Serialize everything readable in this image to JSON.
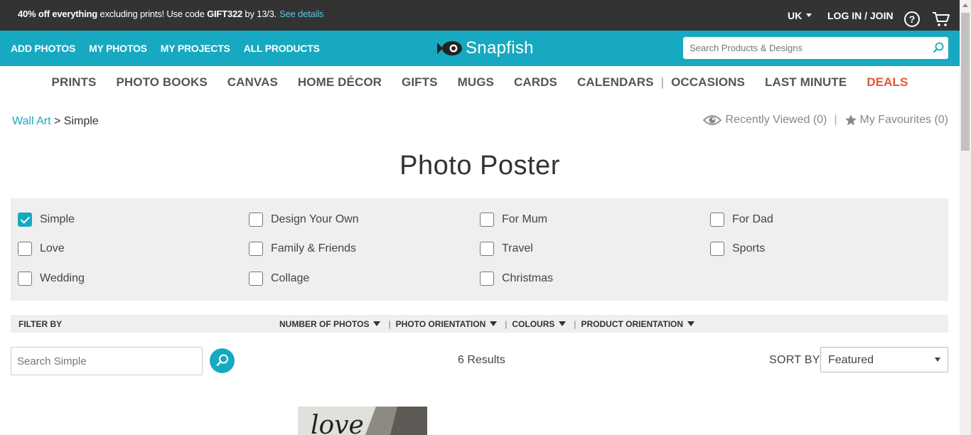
{
  "promo": {
    "bold": "40% off everything",
    "text_mid": " excluding prints! Use code ",
    "code": "GIFT322",
    "text_end": " by 13/3.",
    "link": "See details"
  },
  "util": {
    "region": "UK",
    "login": "LOG IN / JOIN",
    "help": "?"
  },
  "bluenav": {
    "links": [
      "ADD PHOTOS",
      "MY PHOTOS",
      "MY PROJECTS",
      "ALL PRODUCTS"
    ],
    "logo": "Snapfish",
    "search_placeholder": "Search Products & Designs"
  },
  "catnav": {
    "items": [
      "PRINTS",
      "PHOTO BOOKS",
      "CANVAS",
      "HOME DÉCOR",
      "GIFTS",
      "MUGS",
      "CARDS",
      "CALENDARS"
    ],
    "separator": "|",
    "items2": [
      "OCCASIONS",
      "LAST MINUTE"
    ],
    "deals": "DEALS"
  },
  "breadcrumb": {
    "parent": "Wall Art",
    "sep": " > ",
    "current": "Simple"
  },
  "recent": {
    "viewed": "Recently Viewed (0)",
    "divider": "|",
    "favourites": "My Favourites (0)"
  },
  "page_title": "Photo Poster",
  "filters": [
    {
      "label": "Simple",
      "checked": true
    },
    {
      "label": "Design Your Own",
      "checked": false
    },
    {
      "label": "For Mum",
      "checked": false
    },
    {
      "label": "For Dad",
      "checked": false
    },
    {
      "label": "Love",
      "checked": false
    },
    {
      "label": "Family & Friends",
      "checked": false
    },
    {
      "label": "Travel",
      "checked": false
    },
    {
      "label": "Sports",
      "checked": false
    },
    {
      "label": "Wedding",
      "checked": false
    },
    {
      "label": "Collage",
      "checked": false
    },
    {
      "label": "Christmas",
      "checked": false
    }
  ],
  "filterbar": {
    "label": "FILTER BY",
    "options": [
      "NUMBER OF PHOTOS",
      "PHOTO ORIENTATION",
      "COLOURS",
      "PRODUCT ORIENTATION"
    ],
    "sep": "|"
  },
  "results_row": {
    "search_placeholder": "Search Simple",
    "results": "6 Results",
    "sort_label": "SORT BY",
    "sort_value": "Featured"
  },
  "product": {
    "thumb_text": "love"
  },
  "colors": {
    "brand": "#17a9c1",
    "dark": "#333333",
    "deals": "#e3572d",
    "panel": "#efefef"
  }
}
